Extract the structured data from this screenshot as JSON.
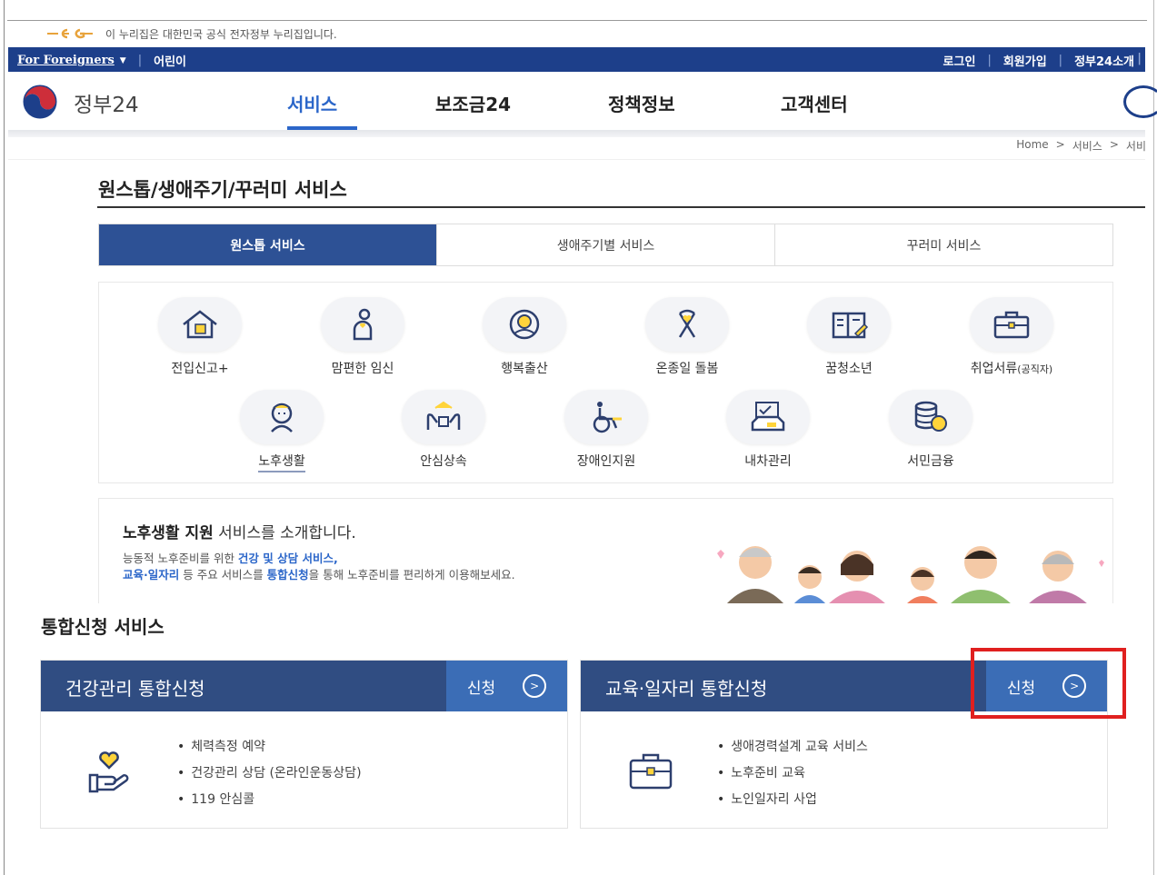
{
  "notice": {
    "text": "이 누리집은 대한민국 공식 전자정부 누리집입니다."
  },
  "utilbar": {
    "foreigners": "For Foreigners",
    "kids": "어린이",
    "login": "로그인",
    "signup": "회원가입",
    "about": "정부24소개"
  },
  "header": {
    "brand": "정부24",
    "nav": [
      "서비스",
      "보조금24",
      "정책정보",
      "고객센터"
    ],
    "active_nav": "서비스"
  },
  "breadcrumb": [
    "Home",
    ">",
    "서비스",
    ">",
    "서비"
  ],
  "page_title": "원스톱/생애주기/꾸러미 서비스",
  "tabs": [
    "원스톱 서비스",
    "생애주기별 서비스",
    "꾸러미 서비스"
  ],
  "active_tab": "원스톱 서비스",
  "services_row1": [
    {
      "label": "전입신고+",
      "icon": "house-icon"
    },
    {
      "label": "맘편한 임신",
      "icon": "pregnancy-icon"
    },
    {
      "label": "행복출산",
      "icon": "baby-icon"
    },
    {
      "label": "온종일 돌봄",
      "icon": "ribbon-icon"
    },
    {
      "label": "꿈청소년",
      "icon": "book-icon"
    },
    {
      "label": "취업서류",
      "label_small": "(공직자)",
      "icon": "briefcase-icon"
    }
  ],
  "services_row2": [
    {
      "label": "노후생활",
      "icon": "elder-icon"
    },
    {
      "label": "안심상속",
      "icon": "inheritance-icon"
    },
    {
      "label": "장애인지원",
      "icon": "wheelchair-icon"
    },
    {
      "label": "내차관리",
      "icon": "car-icon"
    },
    {
      "label": "서민금융",
      "icon": "coins-icon"
    }
  ],
  "intro": {
    "headline_bold": "노후생활 지원",
    "headline_rest": " 서비스를 소개합니다.",
    "line1_pre": "능동적 노후준비를 위한 ",
    "line1_blue": "건강 및 상담 서비스,",
    "line2_blue1": "교육·일자리",
    "line2_mid": " 등 주요 서비스를 ",
    "line2_blue2": "통합신청",
    "line2_post": "을 통해 노후준비를 편리하게 이용해보세요."
  },
  "section_title": "통합신청 서비스",
  "apply_cards": [
    {
      "title": "건강관리 통합신청",
      "button": "신청",
      "icon": "heart-hand-icon",
      "items": [
        "체력측정 예약",
        "건강관리 상담 (온라인운동상담)",
        "119 안심콜"
      ]
    },
    {
      "title": "교육·일자리 통합신청",
      "button": "신청",
      "icon": "briefcase-icon",
      "items": [
        "생애경력설계 교육 서비스",
        "노후준비 교육",
        "노인일자리 사업"
      ]
    }
  ],
  "colors": {
    "utilbar": "#1d3f8a",
    "accent": "#2b66c9",
    "tab_active": "#2d5195",
    "card_head": "#304d82",
    "card_button": "#3b6db6",
    "highlight": "#e0201f"
  }
}
